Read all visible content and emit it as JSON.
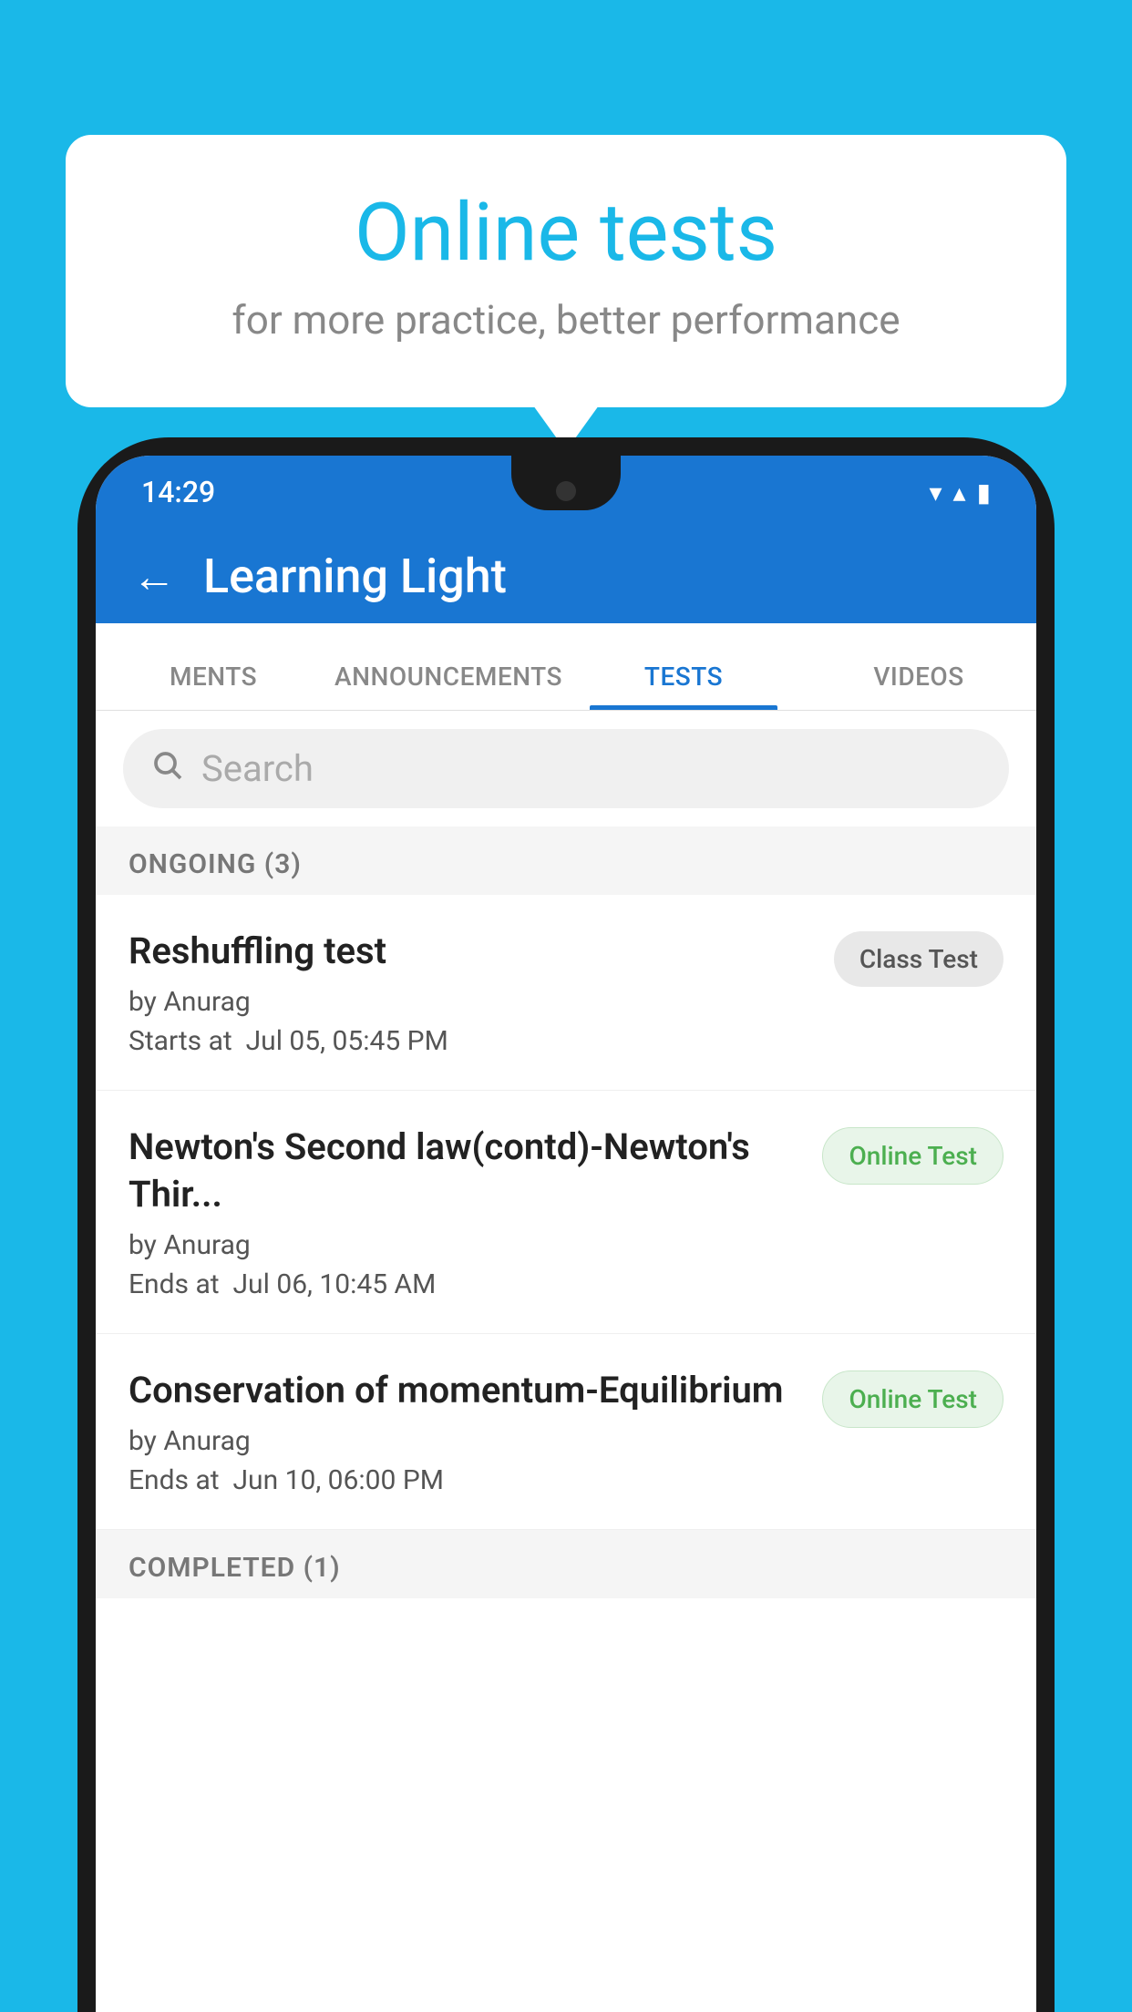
{
  "background": {
    "color": "#1ab8e8"
  },
  "bubble": {
    "title": "Online tests",
    "subtitle": "for more practice, better performance"
  },
  "phone": {
    "status": {
      "time": "14:29",
      "wifi_icon": "▼",
      "signal_icon": "▲",
      "battery_icon": "▮"
    },
    "header": {
      "back_label": "←",
      "title": "Learning Light"
    },
    "tabs": [
      {
        "label": "MENTS",
        "active": false
      },
      {
        "label": "ANNOUNCEMENTS",
        "active": false
      },
      {
        "label": "TESTS",
        "active": true
      },
      {
        "label": "VIDEOS",
        "active": false
      }
    ],
    "search": {
      "placeholder": "Search"
    },
    "sections": [
      {
        "title": "ONGOING (3)",
        "tests": [
          {
            "name": "Reshuffling test",
            "by": "by Anurag",
            "date_label": "Starts at",
            "date": "Jul 05, 05:45 PM",
            "badge": "Class Test",
            "badge_type": "class"
          },
          {
            "name": "Newton's Second law(contd)-Newton's Thir...",
            "by": "by Anurag",
            "date_label": "Ends at",
            "date": "Jul 06, 10:45 AM",
            "badge": "Online Test",
            "badge_type": "online"
          },
          {
            "name": "Conservation of momentum-Equilibrium",
            "by": "by Anurag",
            "date_label": "Ends at",
            "date": "Jun 10, 06:00 PM",
            "badge": "Online Test",
            "badge_type": "online"
          }
        ]
      },
      {
        "title": "COMPLETED (1)",
        "tests": []
      }
    ]
  }
}
